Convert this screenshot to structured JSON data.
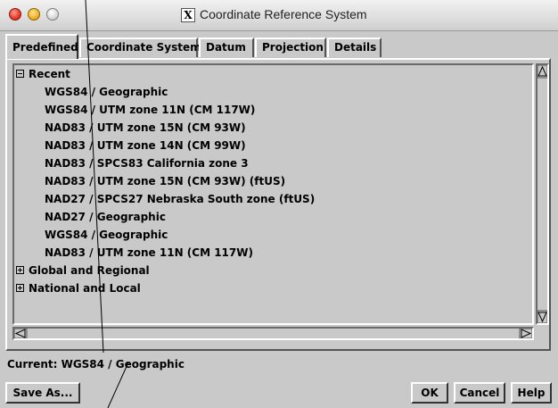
{
  "window": {
    "title": "Coordinate Reference System",
    "app_icon": "x11-icon"
  },
  "tabs": [
    {
      "label": "Predefined",
      "active": true
    },
    {
      "label": "Coordinate System",
      "active": false
    },
    {
      "label": "Datum",
      "active": false
    },
    {
      "label": "Projection",
      "active": false
    },
    {
      "label": "Details",
      "active": false
    }
  ],
  "tree": {
    "groups": [
      {
        "label": "Recent",
        "expanded": true,
        "items": [
          "WGS84 / Geographic",
          "WGS84 / UTM zone 11N (CM 117W)",
          "NAD83 / UTM zone 15N (CM 93W)",
          "NAD83 / UTM zone 14N (CM 99W)",
          "NAD83 / SPCS83 California zone 3",
          "NAD83 / UTM zone 15N (CM 93W) (ftUS)",
          "NAD27 / SPCS27 Nebraska South zone (ftUS)",
          "NAD27 / Geographic",
          "WGS84 / Geographic",
          "NAD83 / UTM zone 11N (CM 117W)"
        ]
      },
      {
        "label": "Global and Regional",
        "expanded": false
      },
      {
        "label": "National and Local",
        "expanded": false
      }
    ]
  },
  "current": {
    "text": "Current: WGS84 / Geographic"
  },
  "buttons": {
    "save_as": "Save As...",
    "ok": "OK",
    "cancel": "Cancel",
    "help": "Help"
  }
}
